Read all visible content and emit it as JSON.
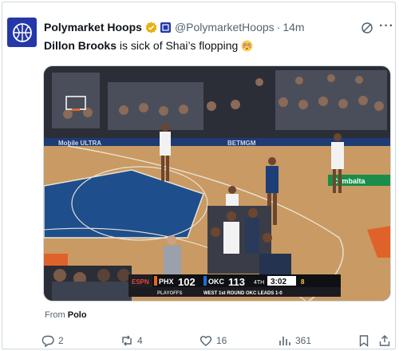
{
  "tweet": {
    "author_name": "Polymarket Hoops",
    "handle": "@PolymarketHoops",
    "separator": "·",
    "time": "14m",
    "text_bold": "Dillon Brooks",
    "text_rest": " is sick of Shai’s flopping",
    "emoji": "😳",
    "from_label": "From",
    "from_source": "Polo"
  },
  "media": {
    "score_bug": {
      "network": "ESPN",
      "team1": "PHX",
      "score1": "102",
      "team2": "OKC",
      "score2": "113",
      "period": "4TH",
      "clock": "3:02",
      "shot_clock": "8",
      "series_info": "WEST 1st ROUND  OKC LEADS 1-0",
      "playoffs_label": "PLAYOFFS"
    }
  },
  "actions": {
    "replies": "2",
    "reposts": "4",
    "likes": "16",
    "views": "361"
  },
  "colors": {
    "brand_blue": "#2438a8",
    "text_secondary": "#536471",
    "verified_gold": "#e8b10f"
  }
}
